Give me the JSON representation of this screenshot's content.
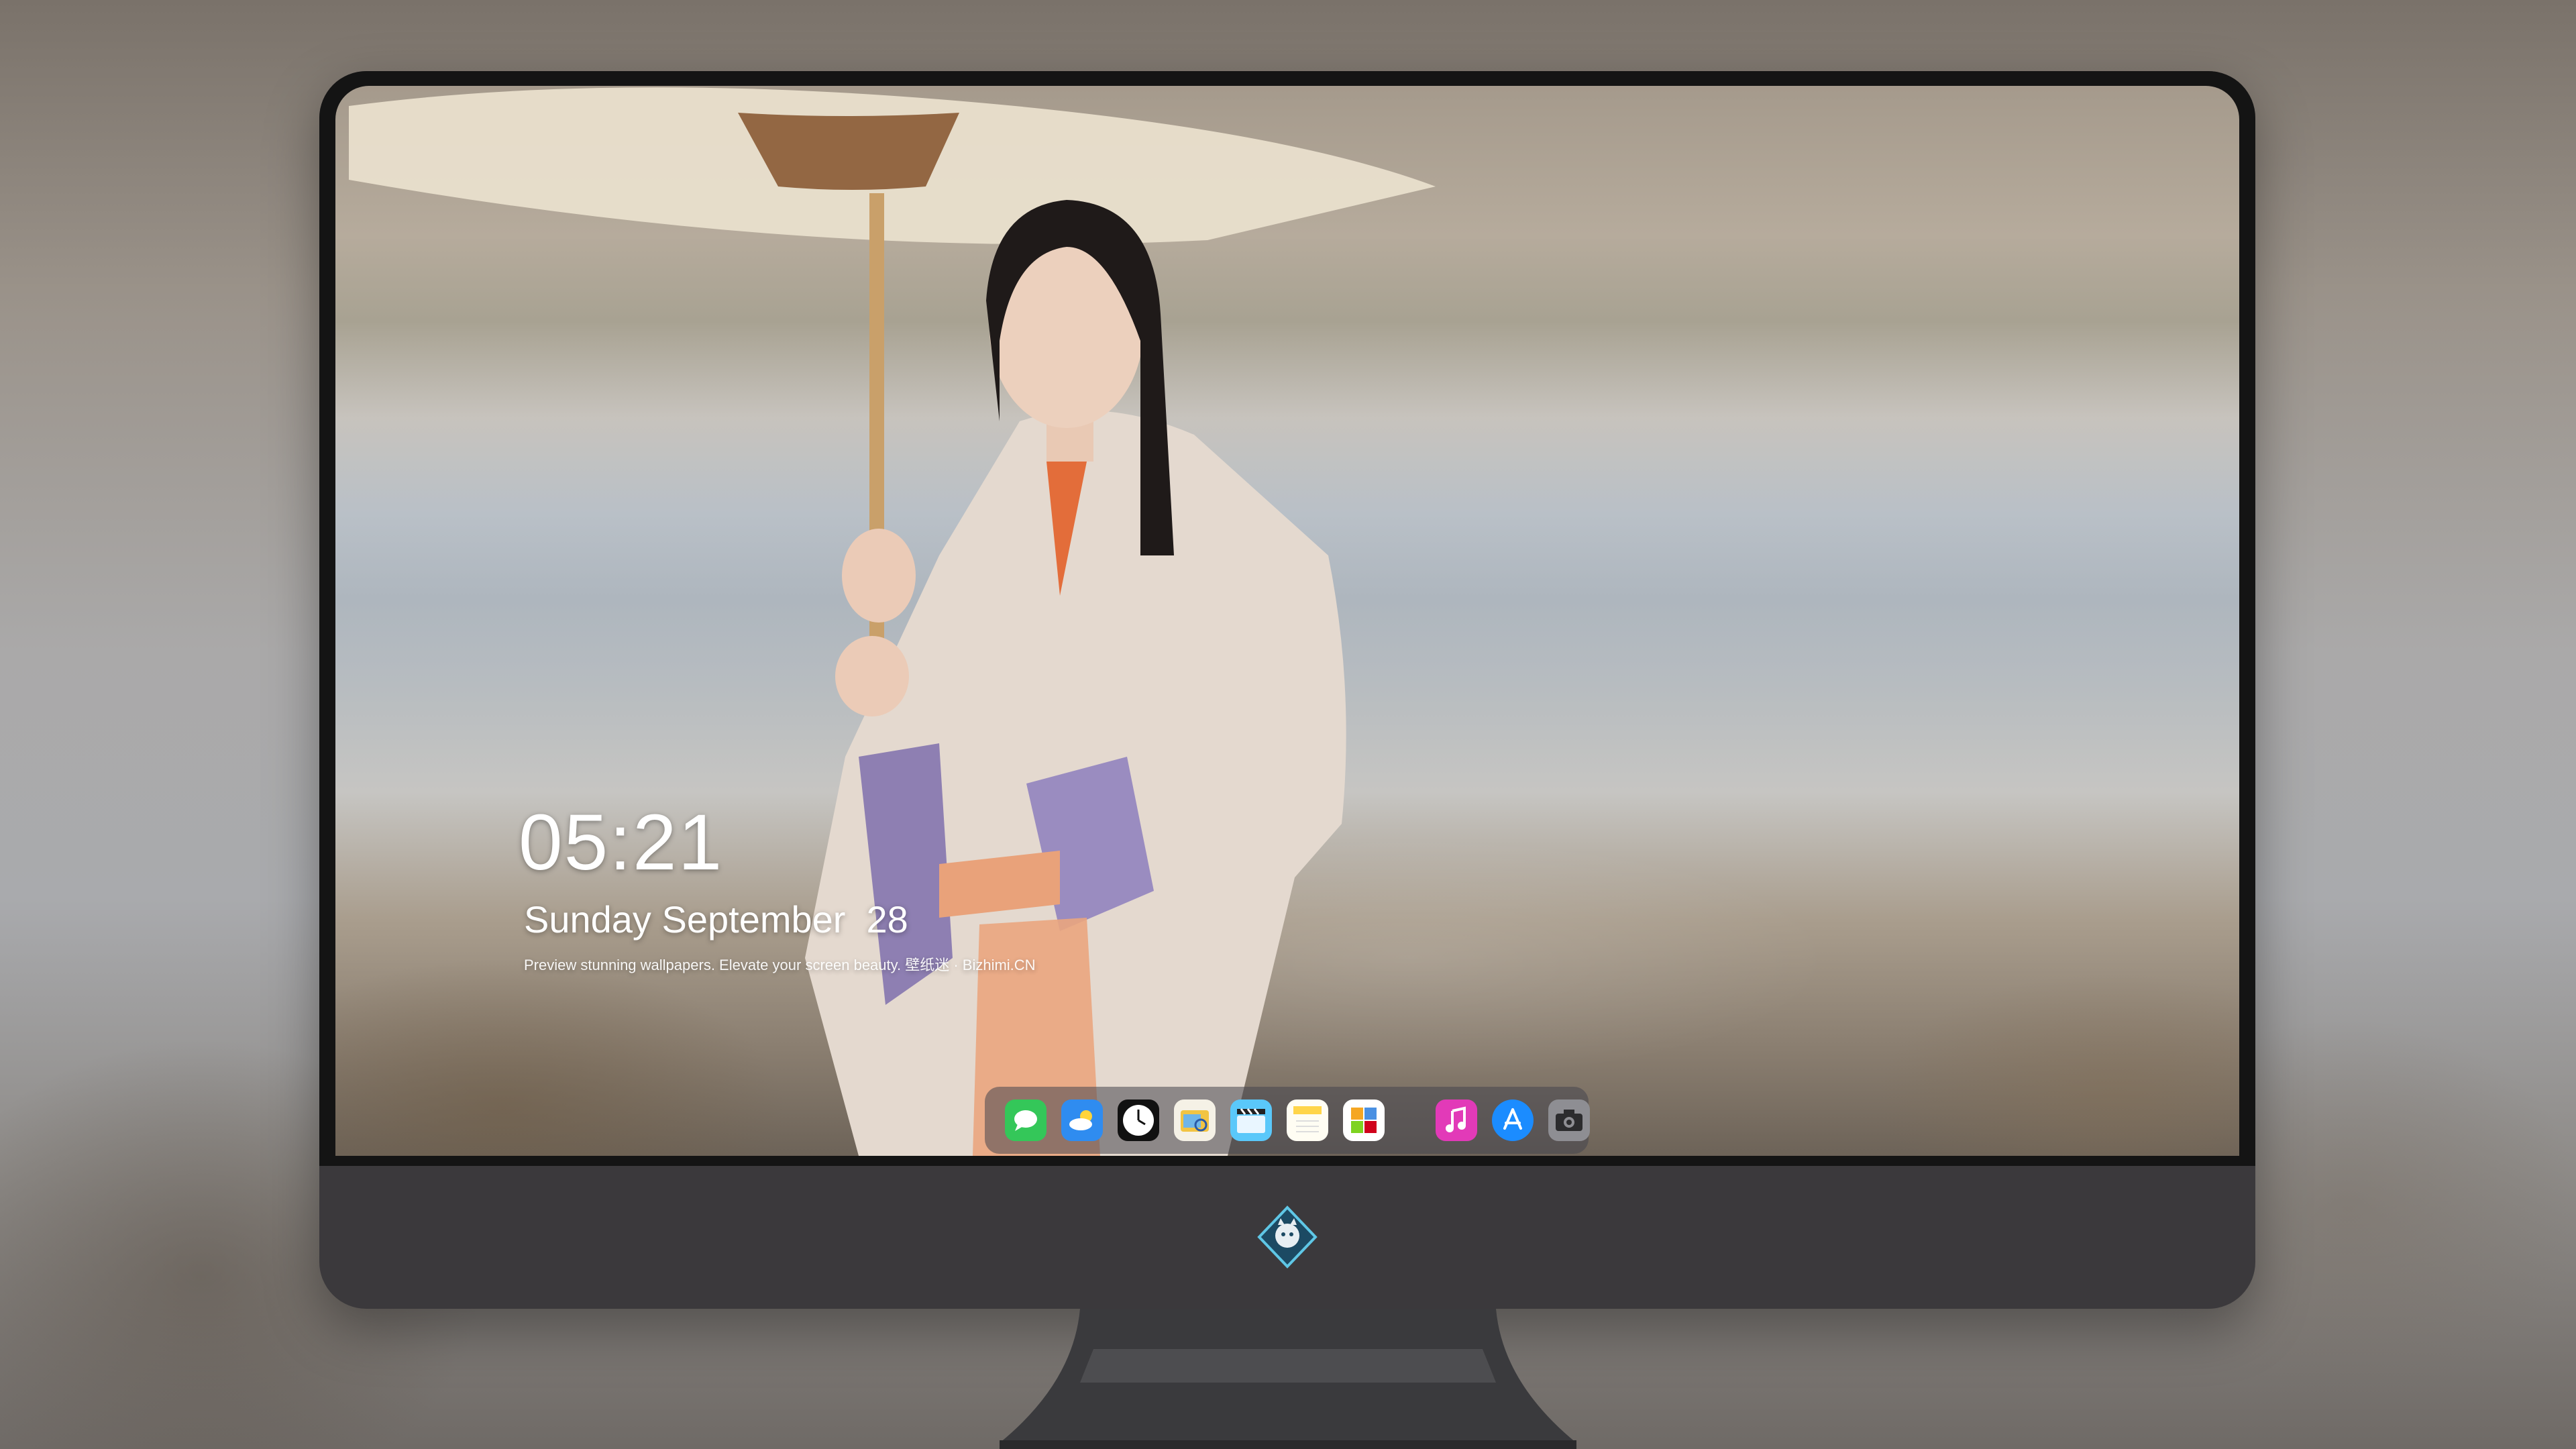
{
  "lockscreen": {
    "time": "05:21",
    "date": "Sunday September  28",
    "tagline": "Preview stunning wallpapers. Elevate your screen beauty. 壁纸迷 · Bizhimi.CN"
  },
  "dock": {
    "apps": [
      {
        "name": "messages",
        "icon": "speech-bubble-icon",
        "color": "#34c759"
      },
      {
        "name": "weather",
        "icon": "cloud-icon",
        "color": "#2f8cf0"
      },
      {
        "name": "clock",
        "icon": "clock-icon",
        "color": "#111111"
      },
      {
        "name": "preview",
        "icon": "magnifier-photo-icon",
        "color": "#f2c443"
      },
      {
        "name": "video",
        "icon": "clapperboard-icon",
        "color": "#5ac8fa"
      },
      {
        "name": "notes",
        "icon": "notepad-icon",
        "color": "#ffd54a"
      },
      {
        "name": "calendar",
        "icon": "grid-calendar-icon",
        "color": "#ffffff"
      },
      {
        "name": "music",
        "icon": "music-note-icon",
        "color": "#e23ab8"
      },
      {
        "name": "app-store",
        "icon": "app-store-icon",
        "color": "#1b8cff"
      },
      {
        "name": "camera",
        "icon": "camera-icon",
        "color": "#9a9a9a"
      }
    ]
  },
  "colors": {
    "bezel": "#141414",
    "chin": "#3b393c",
    "dock": "rgba(70,70,78,0.55)",
    "text": "#ffffff"
  }
}
